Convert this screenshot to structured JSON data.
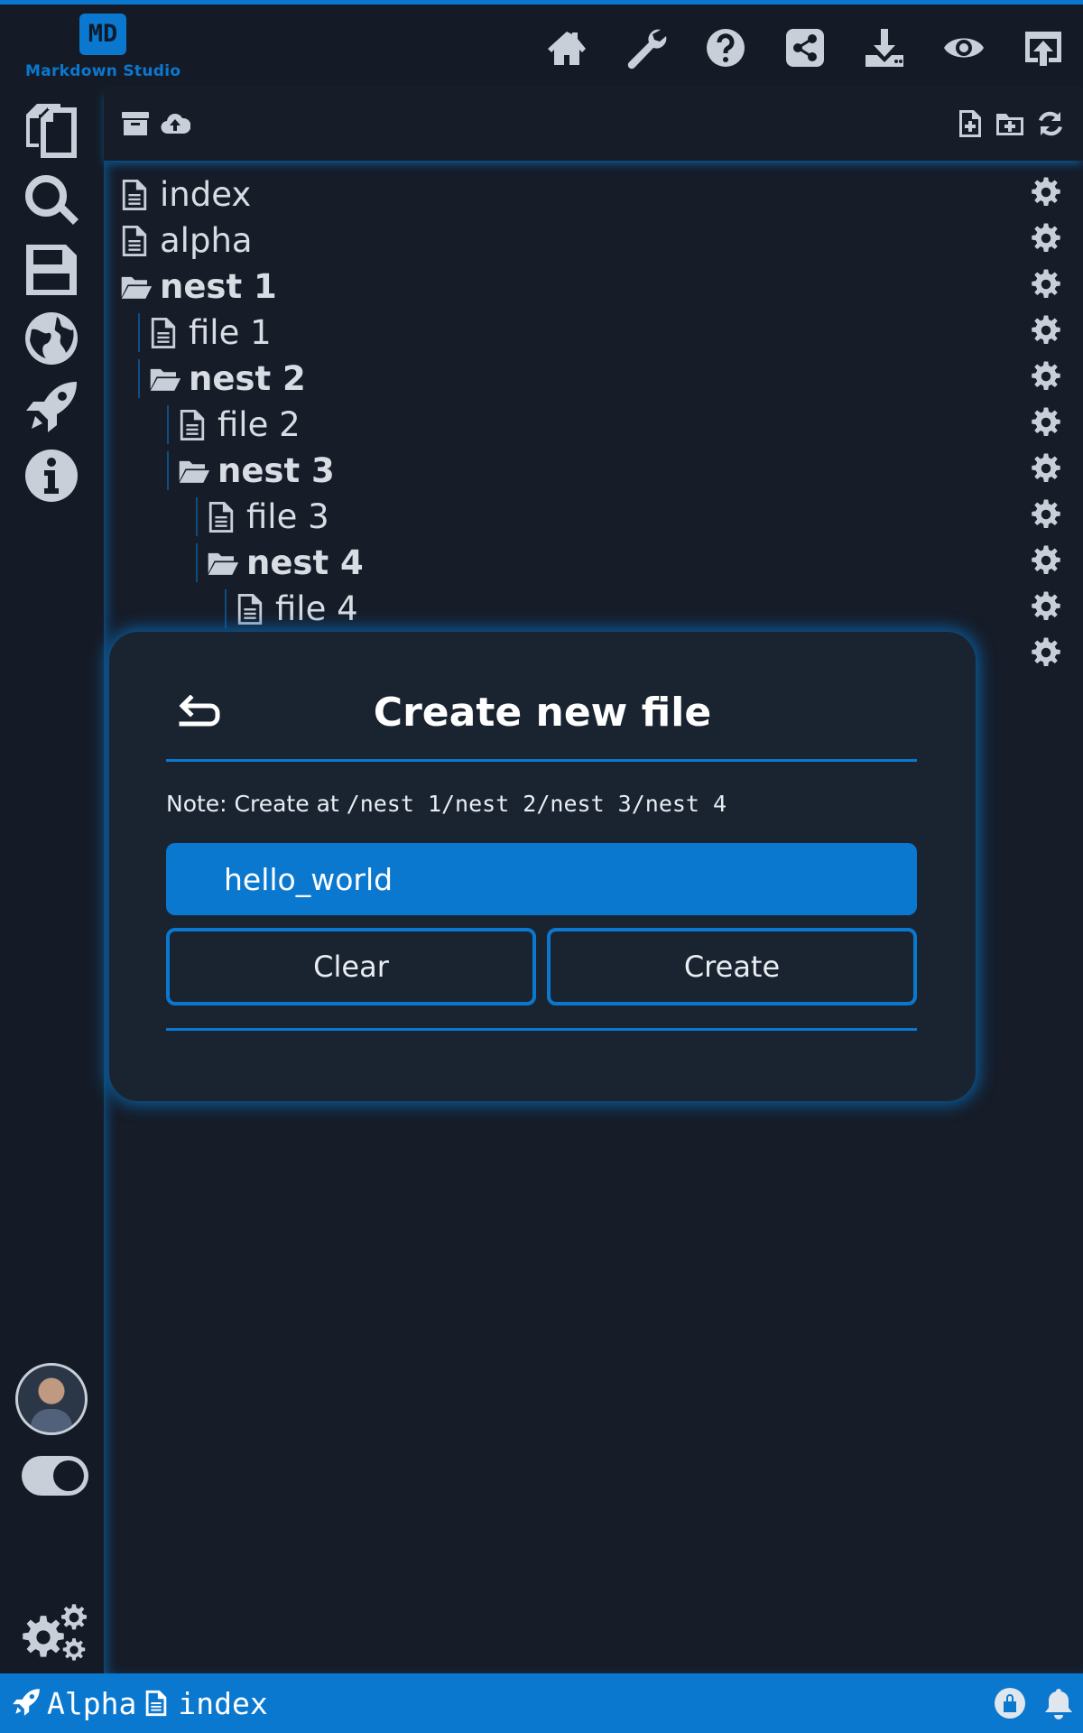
{
  "app": {
    "logo_mark": "MD",
    "name": "Markdown Studio"
  },
  "topbar": {
    "icons": [
      "home-icon",
      "wrench-icon",
      "help-icon",
      "share-icon",
      "download-icon",
      "preview-eye-icon",
      "upload-icon"
    ]
  },
  "sidebar": {
    "icons": [
      "files-icon",
      "search-icon",
      "save-icon",
      "globe-icon",
      "rocket-icon",
      "info-icon"
    ]
  },
  "panel": {
    "toolbar": [
      "archive-icon",
      "cloud-upload-icon",
      "new-file-icon",
      "new-folder-icon",
      "refresh-icon"
    ]
  },
  "tree": [
    {
      "label": "index",
      "type": "file",
      "depth": 0
    },
    {
      "label": "alpha",
      "type": "file",
      "depth": 0
    },
    {
      "label": "nest 1",
      "type": "folder",
      "depth": 0
    },
    {
      "label": "file 1",
      "type": "file",
      "depth": 1
    },
    {
      "label": "nest 2",
      "type": "folder",
      "depth": 1
    },
    {
      "label": "file 2",
      "type": "file",
      "depth": 2
    },
    {
      "label": "nest 3",
      "type": "folder",
      "depth": 2
    },
    {
      "label": "file 3",
      "type": "file",
      "depth": 3
    },
    {
      "label": "nest 4",
      "type": "folder",
      "depth": 3
    },
    {
      "label": "file 4",
      "type": "file",
      "depth": 4
    }
  ],
  "modal": {
    "title": "Create new file",
    "note_prefix": "Note: Create at ",
    "note_path": "/nest 1/nest 2/nest 3/nest 4",
    "input_value": "hello_world",
    "clear_label": "Clear",
    "create_label": "Create"
  },
  "statusbar": {
    "project": "Alpha",
    "file": "index"
  },
  "colors": {
    "accent": "#0b78d0",
    "background": "#151b26",
    "modal": "#1a2431"
  }
}
